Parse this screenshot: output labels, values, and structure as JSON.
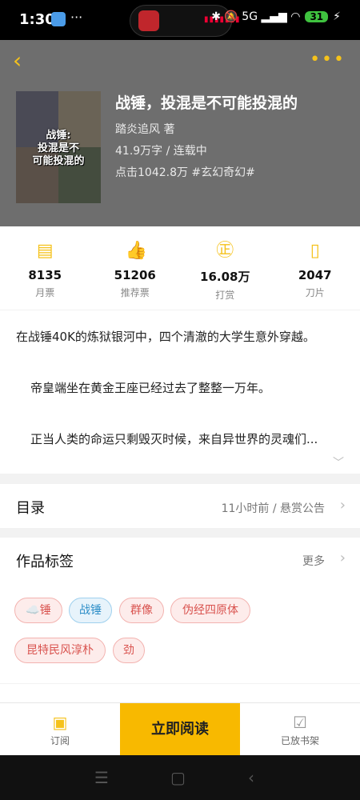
{
  "status": {
    "time": "1:30",
    "dots": "···",
    "right_icons": "✱ 🔕 5G ▂▄▆ ◠",
    "battery": "31",
    "charging": "⚡",
    "island_meter": "▮▮▮▮▮▮▮"
  },
  "book": {
    "title": "战锤，投混是不可能投混的",
    "cover_text": "战锤:\n投混是不\n可能投混的",
    "author": "踏炎追风  著",
    "words": "41.9万字 / 连载中",
    "clicks": "点击1042.8万  #玄幻奇幻#"
  },
  "stats": [
    {
      "icon": "ticket-icon",
      "glyph": "▤",
      "value": "8135",
      "label": "月票"
    },
    {
      "icon": "thumbs-up-icon",
      "glyph": "👍",
      "value": "51206",
      "label": "推荐票"
    },
    {
      "icon": "reward-icon",
      "glyph": "㊣",
      "value": "16.08万",
      "label": "打赏"
    },
    {
      "icon": "blade-icon",
      "glyph": "▯",
      "value": "2047",
      "label": "刀片"
    }
  ],
  "intro": [
    "在战锤40K的炼狱银河中，四个清澈的大学生意外穿越。",
    "帝皇端坐在黄金王座已经过去了整整一万年。",
    "正当人类的命运只剩毁灭时候，来自异世界的灵魂们..."
  ],
  "catalog": {
    "label": "目录",
    "side": "11小时前 / 悬赏公告"
  },
  "tags_section": {
    "label": "作品标签",
    "side": "更多"
  },
  "tags": [
    {
      "text": "☁️锤",
      "style": "red"
    },
    {
      "text": "战锤",
      "style": "blue"
    },
    {
      "text": "群像",
      "style": "red"
    },
    {
      "text": "伪经四原体",
      "style": "red"
    },
    {
      "text": "昆特民风淳朴",
      "style": "red"
    },
    {
      "text": "劲",
      "style": "red"
    }
  ],
  "bottom": {
    "subscribe": "订阅",
    "read": "立即阅读",
    "shelf": "已放书架"
  },
  "nav": {
    "menu": "☰",
    "home": "▢",
    "back": "‹"
  }
}
